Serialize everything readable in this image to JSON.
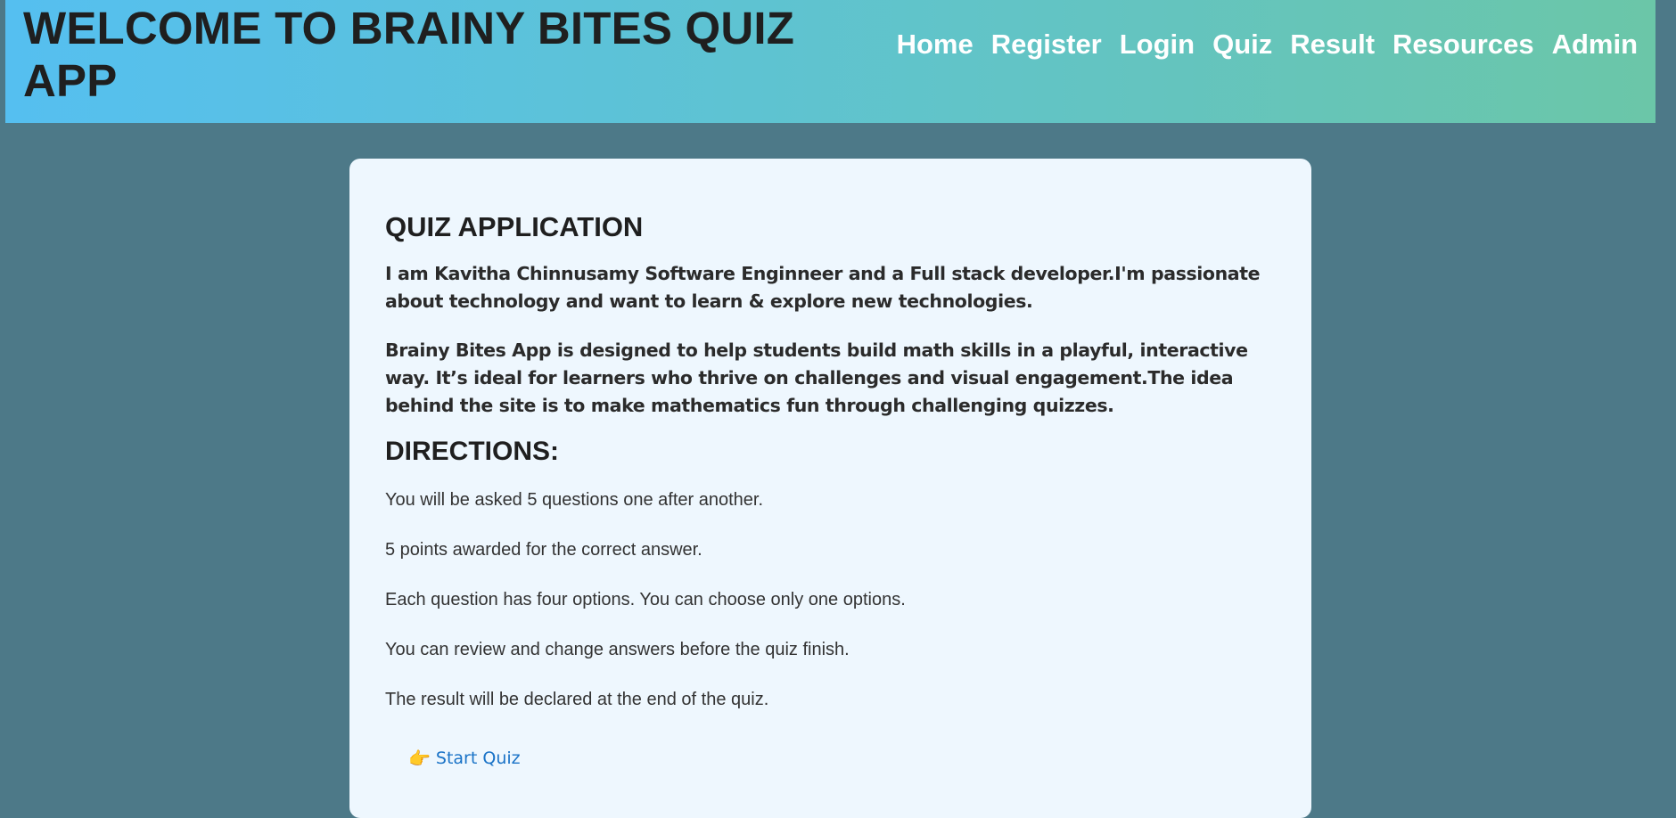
{
  "header": {
    "title": "WELCOME TO BRAINY BITES QUIZ APP",
    "nav": [
      {
        "label": "Home"
      },
      {
        "label": "Register"
      },
      {
        "label": "Login"
      },
      {
        "label": "Quiz"
      },
      {
        "label": "Result"
      },
      {
        "label": "Resources"
      },
      {
        "label": "Admin"
      }
    ]
  },
  "main": {
    "heading": "QUIZ APPLICATION",
    "bio_1": "I am Kavitha Chinnusamy Software Enginneer and a Full stack developer.I'm passionate about technology and want to learn & explore new technologies.",
    "bio_2": "Brainy Bites App is designed to help students build math skills in a playful, interactive way. It’s ideal for learners who thrive on challenges and visual engagement.The idea behind the site is to make mathematics fun through challenging quizzes.",
    "directions_heading": "DIRECTIONS:",
    "directions": [
      "You will be asked 5 questions one after another.",
      "5 points awarded for the correct answer.",
      "Each question has four options. You can choose only one options.",
      "You can review and change answers before the quiz finish.",
      "The result will be declared at the end of the quiz."
    ],
    "start_icon": "👉",
    "start_label": "Start Quiz"
  }
}
